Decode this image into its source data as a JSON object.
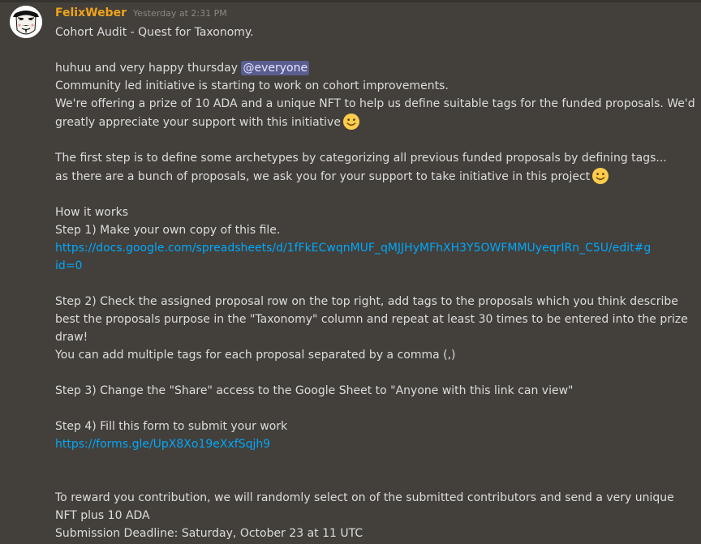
{
  "message": {
    "author": "FelixWeber",
    "timestamp": "Yesterday at 2:31 PM",
    "title": "Cohort Audit - Quest for Taxonomy.",
    "greeting": "huhuu and very happy thursday ",
    "mention": "@everyone",
    "intro": "Community led initiative is starting to work on cohort improvements.",
    "prize_line1": "We're offering a prize of 10 ADA and a unique NFT to help us define suitable tags for the funded proposals. We'd",
    "prize_line2": "greatly appreciate your support with this initiative",
    "first_step_line1": "The first step is to define some archetypes by categorizing all previous funded proposals by defining tags...",
    "first_step_line2": "as there are a bunch of proposals, we ask you for your support to take initiative in this project",
    "how_it_works": "How it works",
    "step1": "Step 1) Make your own copy of this file.",
    "step1_link_line1": "https://docs.google.com/spreadsheets/d/1fFkECwqnMUF_qMJJHyMFhXH3Y5OWFMMUyeqrIRn_C5U/edit#g",
    "step1_link_line2": "id=0",
    "step2_line1": "Step 2) Check the assigned proposal row on the top right, add tags to the proposals which you think describe",
    "step2_line2": "best the proposals purpose in the \"Taxonomy\" column and repeat at least 30 times to be entered into the prize",
    "step2_line3": "draw!",
    "step2_line4": "You can add multiple tags for each proposal separated by a comma (,)",
    "step3": "Step 3) Change the \"Share\" access to the Google Sheet to \"Anyone with this link can view\"",
    "step4": "Step 4)  Fill this form to submit your work",
    "step4_link": "https://forms.gle/UpX8Xo19eXxfSqjh9",
    "reward_line1": "To reward you contribution, we will randomly select on of the submitted contributors and send a very unique",
    "reward_line2": "NFT plus 10 ADA",
    "deadline": "Submission Deadline: Saturday, October 23 at 11 UTC"
  },
  "icons": {
    "avatar": "guy-fawkes-mask-avatar",
    "emoji": "slightly-smiling-face-emoji"
  },
  "colors": {
    "background": "#433f3a",
    "username": "#f0a41b",
    "link": "#00a8fc",
    "mention_bg": "#5a5d8f",
    "text": "#dcddde"
  }
}
